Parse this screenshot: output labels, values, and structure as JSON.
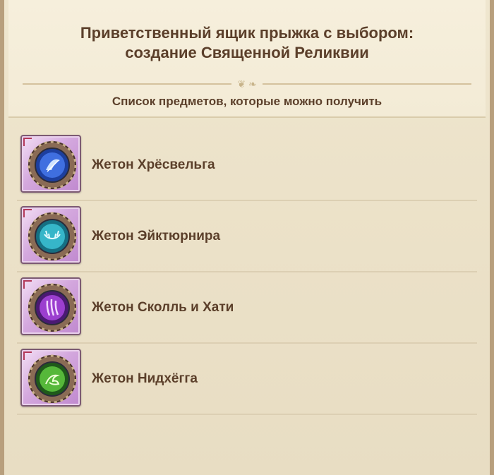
{
  "header": {
    "title_line1": "Приветственный ящик прыжка с выбором:",
    "title_line2": "создание Священной Реликвии",
    "subtitle": "Список предметов, которые можно получить"
  },
  "items": [
    {
      "label": "Жетон Хрёсвельга",
      "icon": "blue-feather-token-icon",
      "color": "#3f6fe0"
    },
    {
      "label": "Жетон Эйктюрнира",
      "icon": "cyan-antler-token-icon",
      "color": "#36b6c9"
    },
    {
      "label": "Жетон Сколль и Хати",
      "icon": "purple-claw-token-icon",
      "color": "#9b3fcf"
    },
    {
      "label": "Жетон Нидхёгга",
      "icon": "green-dragon-token-icon",
      "color": "#56b83a"
    }
  ]
}
